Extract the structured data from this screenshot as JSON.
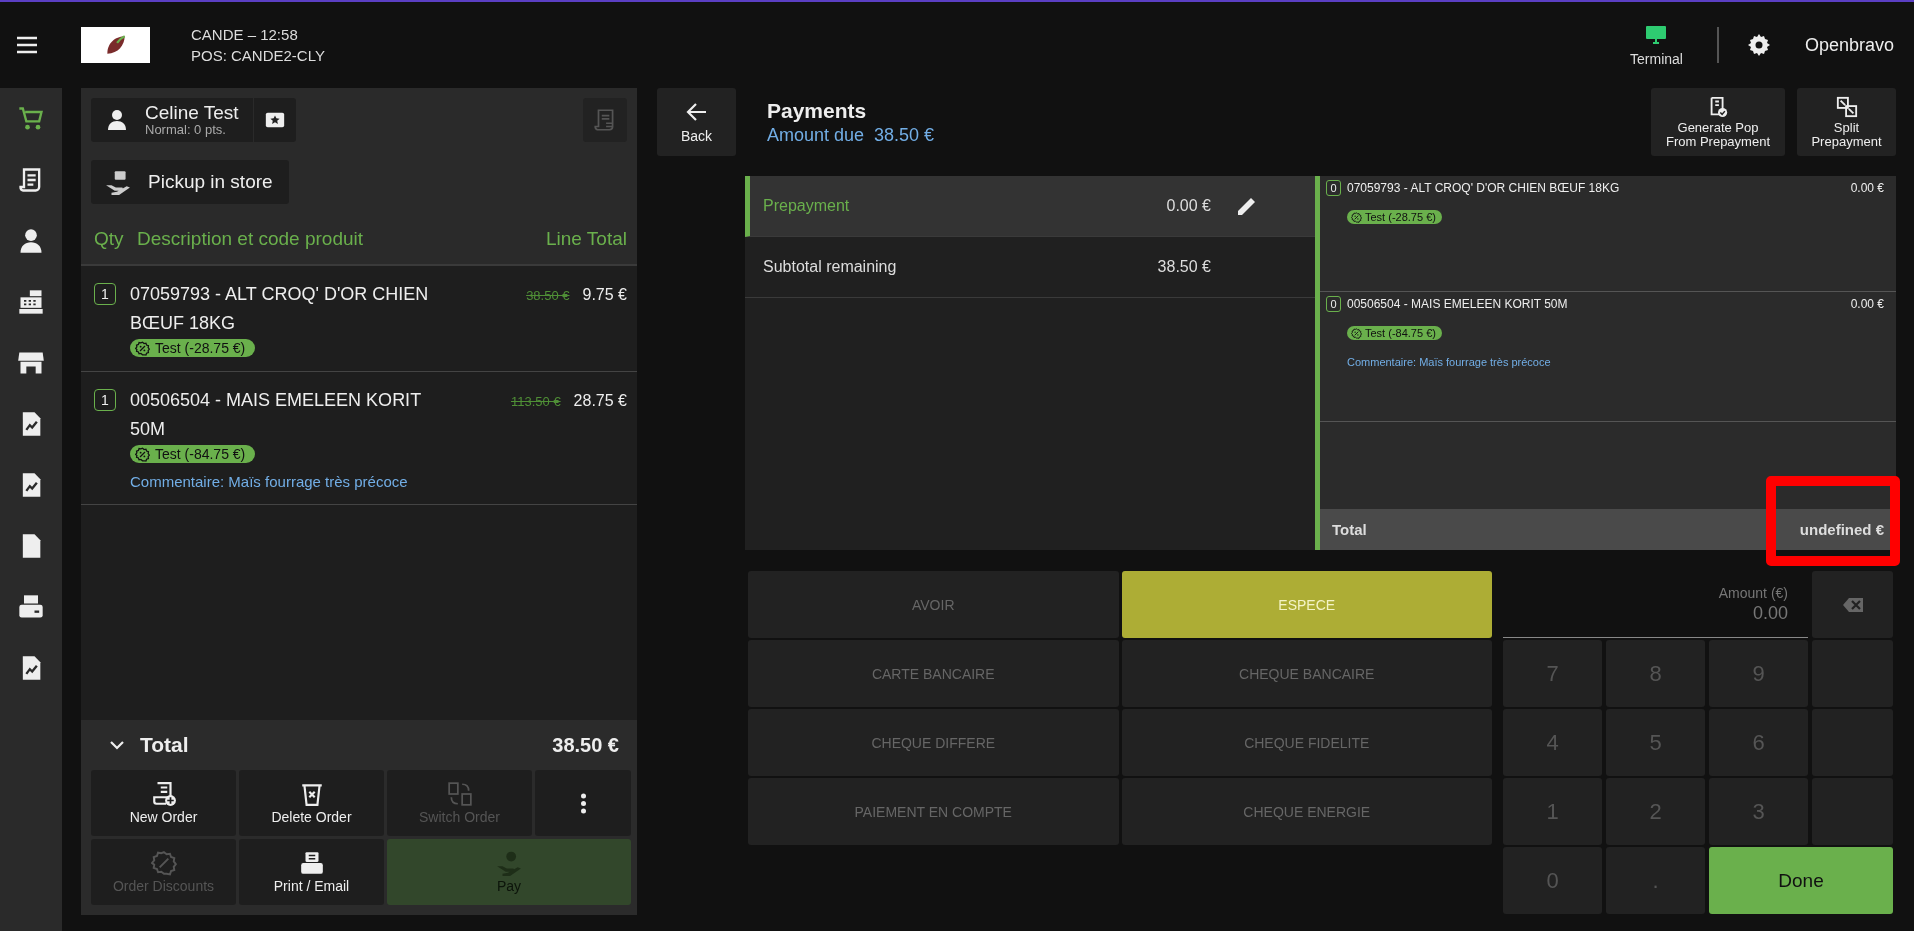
{
  "header": {
    "store_time": "CANDE – 12:58",
    "pos": "POS: CANDE2-CLY",
    "terminal": "Terminal",
    "user": "Openbravo"
  },
  "sidebar": {
    "items": [
      {
        "kind": "cart",
        "selected": true
      },
      {
        "kind": "receipt",
        "selected": false
      },
      {
        "kind": "person",
        "selected": false
      },
      {
        "kind": "register",
        "selected": false
      },
      {
        "kind": "store",
        "selected": false
      },
      {
        "kind": "report",
        "selected": false
      },
      {
        "kind": "report",
        "selected": false
      },
      {
        "kind": "document",
        "selected": false
      },
      {
        "kind": "printer",
        "selected": false
      },
      {
        "kind": "report",
        "selected": false
      }
    ]
  },
  "customer": {
    "name": "Celine Test",
    "loyalty": "Normal: 0 pts."
  },
  "delivery": {
    "label": "Pickup in store"
  },
  "order": {
    "columns": [
      "Qty",
      "Description et code produit",
      "Line Total"
    ],
    "lines": [
      {
        "qty": "1",
        "description": "07059793 - ALT CROQ' D'OR CHIEN BŒUF 18KG",
        "original_price": "38.50 €",
        "price": "9.75 €",
        "discount": "Test (-28.75 €)"
      },
      {
        "qty": "1",
        "description": "00506504 - MAIS EMELEEN KORIT 50M",
        "original_price": "113.50 €",
        "price": "28.75 €",
        "discount": "Test (-84.75 €)",
        "comment": "Commentaire: Maïs fourrage très précoce"
      }
    ],
    "total_label": "Total",
    "total": "38.50 €"
  },
  "actions": [
    {
      "kind": "new",
      "label": "New Order",
      "disabled": false
    },
    {
      "kind": "delete",
      "label": "Delete Order",
      "disabled": false
    },
    {
      "kind": "switch",
      "label": "Switch Order",
      "disabled": true
    },
    {
      "kind": "more",
      "disabled": false
    },
    {
      "kind": "discounts",
      "label": "Order Discounts",
      "disabled": true
    },
    {
      "kind": "print",
      "label": "Print / Email",
      "disabled": false
    },
    {
      "kind": "pay",
      "label": "Pay",
      "disabled": true
    }
  ],
  "payments": {
    "back": "Back",
    "title": "Payments",
    "amount_due_label": "Amount due",
    "amount_due": "38.50 €",
    "tools": [
      {
        "kind": "generate",
        "label": "Generate Pop From Prepayment"
      },
      {
        "kind": "split",
        "label": "Split Prepayment"
      }
    ],
    "summary": [
      {
        "label": "Prepayment",
        "value": "0.00 €",
        "selected": true,
        "editable": true
      },
      {
        "label": "Subtotal remaining",
        "value": "38.50 €",
        "selected": false,
        "editable": false
      }
    ],
    "lines": [
      {
        "qty": "0",
        "description": "07059793 - ALT CROQ' D'OR CHIEN BŒUF 18KG",
        "amount": "0.00 €",
        "discount": "Test (-28.75 €)"
      },
      {
        "qty": "0",
        "description": "00506504 - MAIS EMELEEN KORIT 50M",
        "amount": "0.00 €",
        "discount": "Test (-84.75 €)",
        "comment": "Commentaire: Maïs fourrage très précoce"
      }
    ],
    "total_label": "Total",
    "total": "undefined €",
    "total_highlighted": true
  },
  "methods": [
    {
      "label": "AVOIR",
      "selected": false
    },
    {
      "label": "ESPECE",
      "selected": true
    },
    {
      "label": "CARTE BANCAIRE",
      "selected": false
    },
    {
      "label": "CHEQUE BANCAIRE",
      "selected": false
    },
    {
      "label": "CHEQUE DIFFERE",
      "selected": false
    },
    {
      "label": "CHEQUE FIDELITE",
      "selected": false
    },
    {
      "label": "PAIEMENT EN COMPTE",
      "selected": false
    },
    {
      "label": "CHEQUE ENERGIE",
      "selected": false
    }
  ],
  "keypad": {
    "amount_label": "Amount (€)",
    "amount": "0.00",
    "keys": [
      "7",
      "8",
      "9",
      "4",
      "5",
      "6",
      "1",
      "2",
      "3",
      "0",
      "."
    ],
    "done": "Done"
  }
}
